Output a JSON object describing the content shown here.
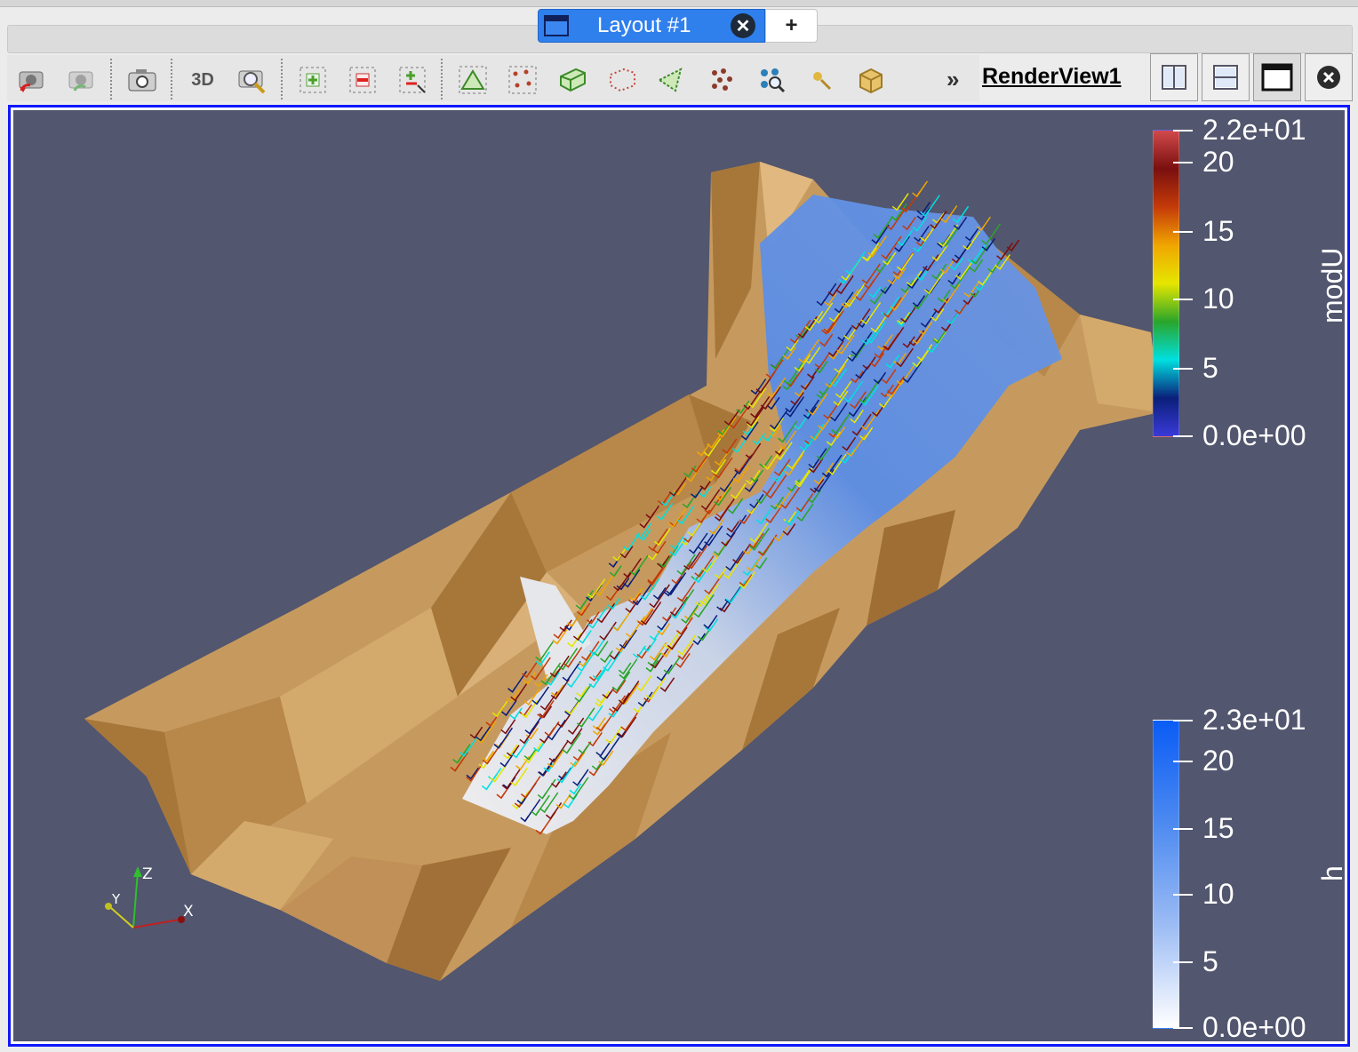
{
  "layout_tab": {
    "label": "Layout #1",
    "close_glyph": "✕",
    "add_glyph": "+"
  },
  "toolbar": {
    "items": [
      {
        "icon": "reset-camera-icon"
      },
      {
        "icon": "reset-camera-closest-icon"
      },
      {
        "icon": "camera-screenshot-icon"
      },
      {
        "label": "3D"
      },
      {
        "icon": "zoom-to-box-icon"
      },
      {
        "icon": "interactive-select-add-icon"
      },
      {
        "icon": "interactive-select-remove-icon"
      },
      {
        "icon": "interactive-select-toggle-icon"
      },
      {
        "icon": "select-cells-on-icon"
      },
      {
        "icon": "select-points-on-icon"
      },
      {
        "icon": "select-cells-frustum-icon"
      },
      {
        "icon": "select-points-frustum-icon"
      },
      {
        "icon": "select-cells-polygon-icon"
      },
      {
        "icon": "select-points-polygon-icon"
      },
      {
        "icon": "interactive-select-points-icon"
      },
      {
        "icon": "hover-points-icon"
      },
      {
        "icon": "block-select-icon"
      }
    ],
    "overflow_glyph": "»"
  },
  "view": {
    "name": "RenderView1",
    "buttons": [
      "split-horizontal-icon",
      "split-vertical-icon",
      "maximize-icon",
      "close-view-icon"
    ]
  },
  "colorbars": [
    {
      "title": "modU",
      "max_label": "2.2e+01",
      "min_label": "0.0e+00",
      "tick_labels": [
        "20",
        "15",
        "10",
        "5"
      ],
      "colors": [
        "#d14a4a",
        "#7a0f0f",
        "#c43a09",
        "#f0a500",
        "#e6e600",
        "#2aa52a",
        "#00e0e0",
        "#0a1f7a",
        "#3a3ad8"
      ]
    },
    {
      "title": "h",
      "max_label": "2.3e+01",
      "min_label": "0.0e+00",
      "tick_labels": [
        "20",
        "15",
        "10",
        "5"
      ],
      "colors": [
        "#0a5cf5",
        "#4d8af0",
        "#9cbcf4",
        "#ffffff"
      ]
    }
  ],
  "axes": {
    "x": "X",
    "y": "Y",
    "z": "Z"
  },
  "scene": {
    "background": "#52566e",
    "terrain": "#c69a5e",
    "water_low": "#f0f2f6",
    "water_high": "#3f7ae6"
  }
}
